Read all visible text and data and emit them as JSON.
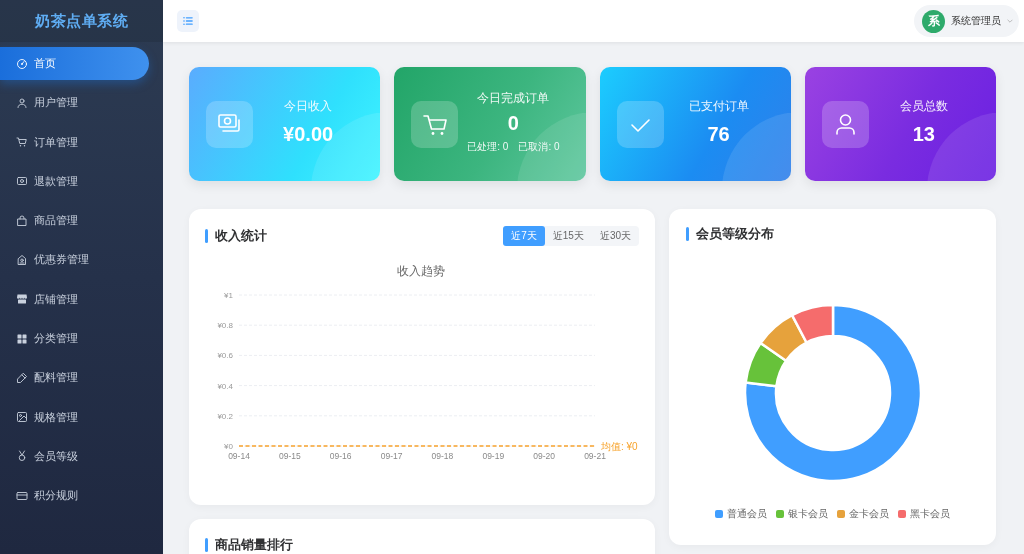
{
  "sidebar": {
    "title": "奶茶点单系统",
    "items": [
      {
        "label": "首页",
        "selected": true
      },
      {
        "label": "用户管理",
        "selected": false
      },
      {
        "label": "订单管理",
        "selected": false
      },
      {
        "label": "退款管理",
        "selected": false
      },
      {
        "label": "商品管理",
        "selected": false
      },
      {
        "label": "优惠券管理",
        "selected": false
      },
      {
        "label": "店铺管理",
        "selected": false
      },
      {
        "label": "分类管理",
        "selected": false
      },
      {
        "label": "配料管理",
        "selected": false
      },
      {
        "label": "规格管理",
        "selected": false
      },
      {
        "label": "会员等级",
        "selected": false
      },
      {
        "label": "积分规则",
        "selected": false
      }
    ]
  },
  "header": {
    "user": {
      "avatar_text": "系",
      "name": "系统管理员"
    }
  },
  "stats": [
    {
      "label": "今日收入",
      "value": "¥0.00"
    },
    {
      "label": "今日完成订单",
      "value": "0",
      "details": [
        "已处理: 0",
        "已取消: 0"
      ]
    },
    {
      "label": "已支付订单",
      "value": "76"
    },
    {
      "label": "会员总数",
      "value": "13"
    }
  ],
  "income_panel": {
    "title": "收入统计",
    "ranges": [
      {
        "label": "近7天",
        "selected": true
      },
      {
        "label": "近15天",
        "selected": false
      },
      {
        "label": "近30天",
        "selected": false
      }
    ],
    "chart_data": {
      "type": "line",
      "title": "收入趋势",
      "categories": [
        "09-14",
        "09-15",
        "09-16",
        "09-17",
        "09-18",
        "09-19",
        "09-20",
        "09-21"
      ],
      "series": [
        {
          "color": "#f7a32c",
          "line_style": "dashed",
          "values": [
            0,
            0,
            0,
            0,
            0,
            0,
            0,
            0
          ]
        }
      ],
      "ylim": [
        0,
        1
      ],
      "yticks": [
        {
          "value": 0,
          "label": "¥0"
        },
        {
          "value": 0.2,
          "label": "¥0.2"
        },
        {
          "value": 0.4,
          "label": "¥0.4"
        },
        {
          "value": 0.6,
          "label": "¥0.6"
        },
        {
          "value": 0.8,
          "label": "¥0.8"
        },
        {
          "value": 1,
          "label": "¥1"
        }
      ],
      "grid": true,
      "ref_lines": [
        {
          "label": "均值: ¥0"
        }
      ]
    }
  },
  "member_panel": {
    "title": "会员等级分布",
    "chart_data": {
      "type": "donut",
      "categories": [
        "普通会员",
        "银卡会员",
        "金卡会员",
        "黑卡会员"
      ],
      "values": [
        76.9,
        7.7,
        7.7,
        7.7
      ],
      "colors": [
        "#409eff",
        "#67c23a",
        "#e6a23c",
        "#f56c6c"
      ]
    }
  },
  "sales_panel": {
    "title": "商品销量排行"
  }
}
